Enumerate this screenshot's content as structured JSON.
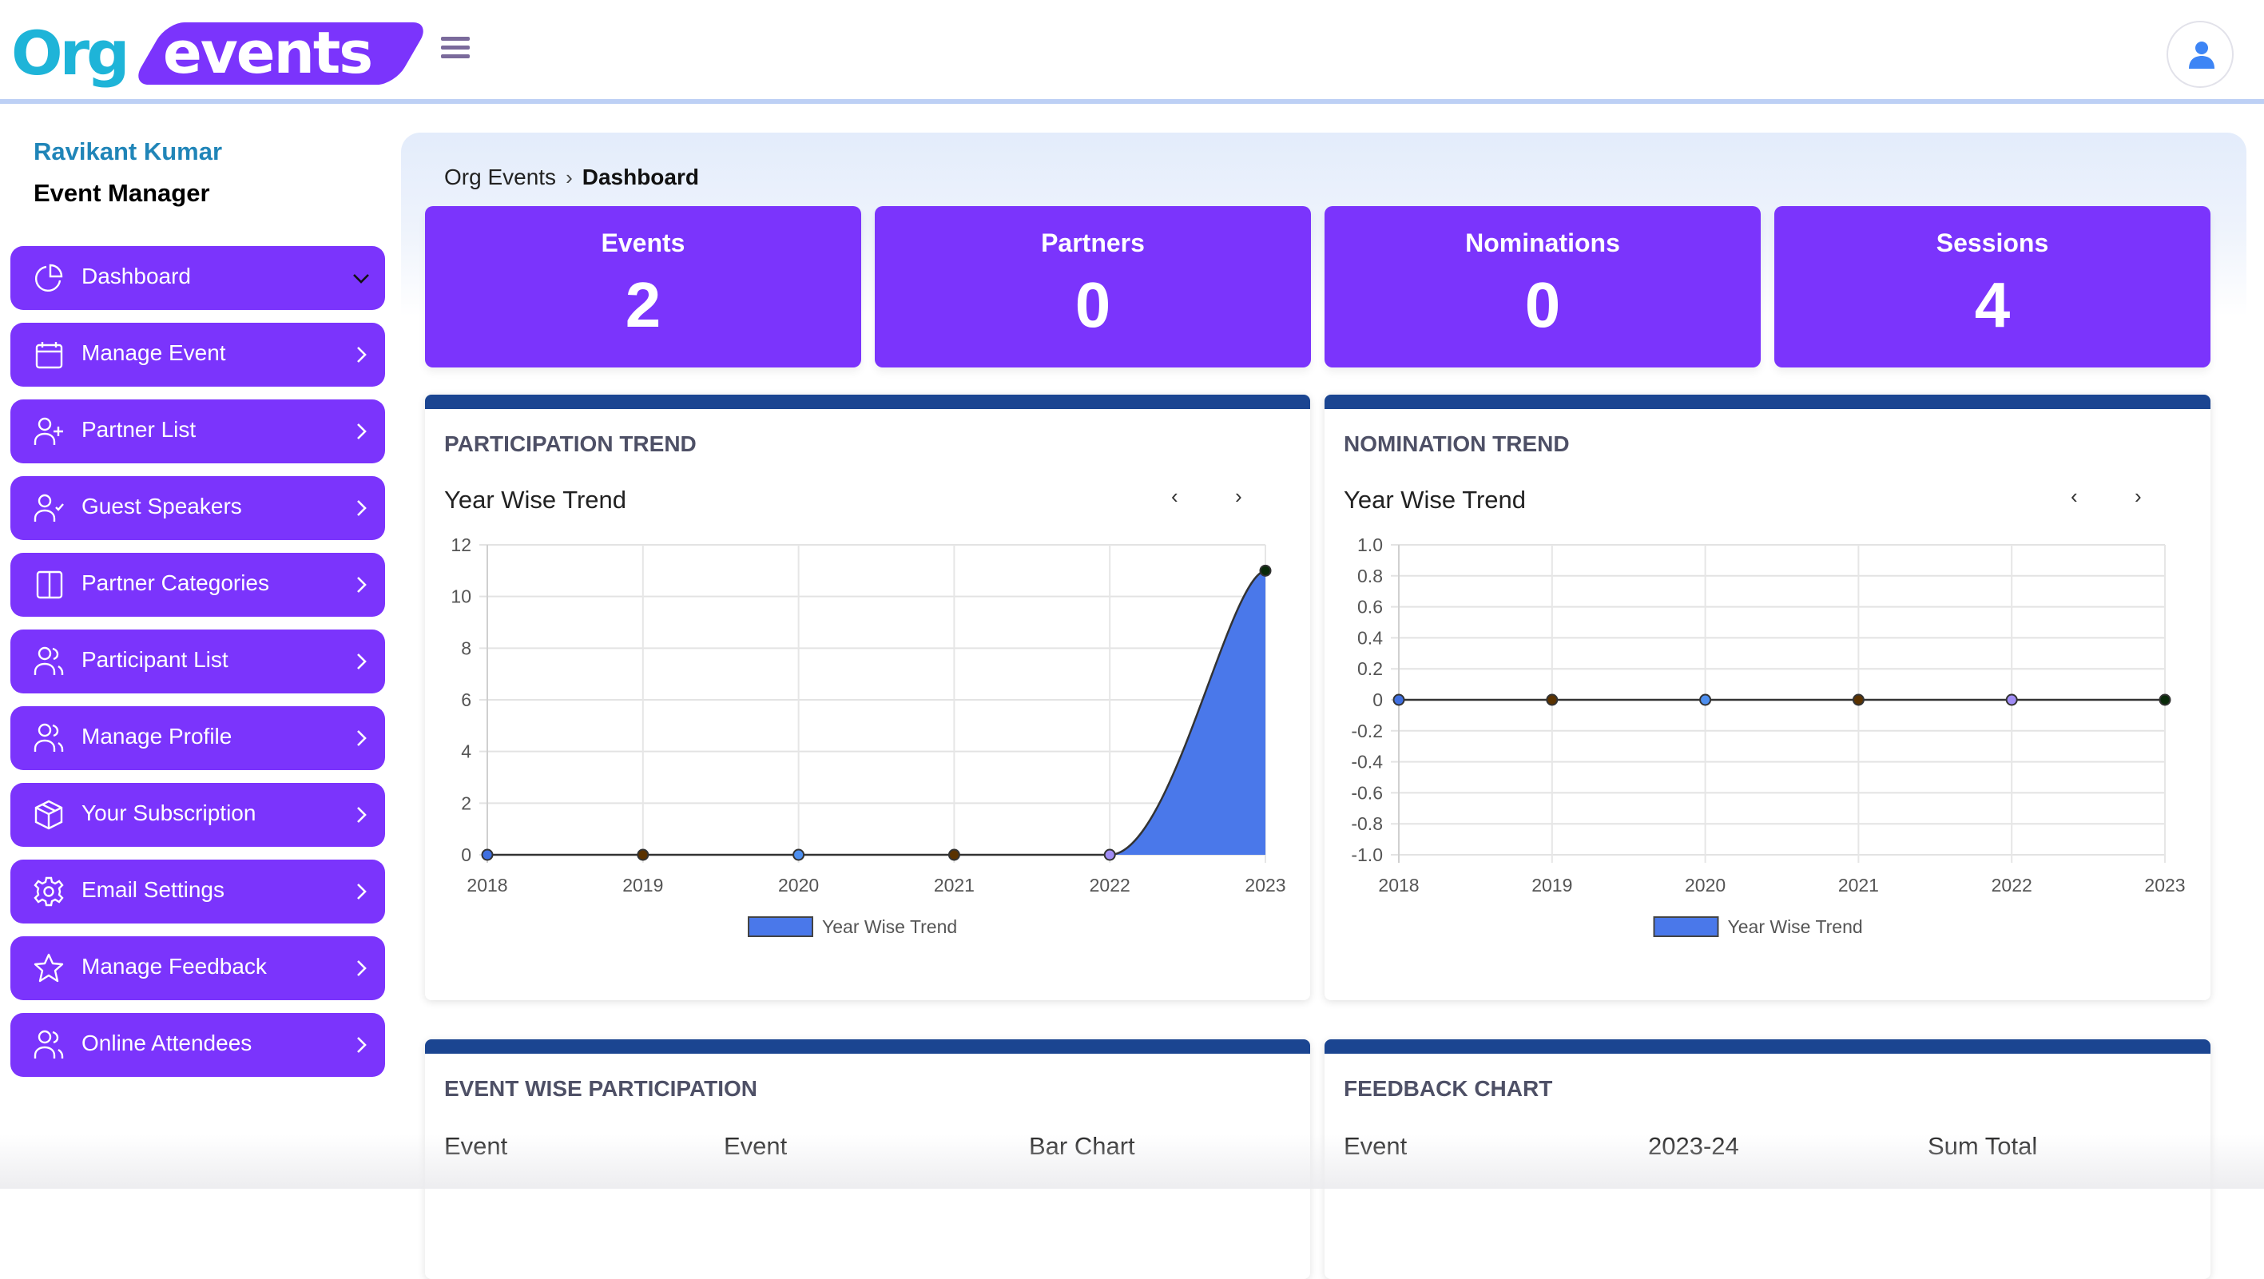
{
  "header": {
    "logo": {
      "part1": "Org",
      "part2": "events"
    },
    "menu_icon": "hamburger-icon",
    "avatar_icon": "user-icon"
  },
  "user": {
    "name": "Ravikant Kumar",
    "role": "Event Manager"
  },
  "sidebar": {
    "items": [
      {
        "label": "Dashboard",
        "icon": "pie-chart-icon",
        "chevron": "chevron-down",
        "active": true
      },
      {
        "label": "Manage Event",
        "icon": "calendar-icon",
        "chevron": "chevron-right"
      },
      {
        "label": "Partner List",
        "icon": "user-plus-icon",
        "chevron": "chevron-right"
      },
      {
        "label": "Guest Speakers",
        "icon": "user-check-icon",
        "chevron": "chevron-right"
      },
      {
        "label": "Partner Categories",
        "icon": "columns-icon",
        "chevron": "chevron-right"
      },
      {
        "label": "Participant List",
        "icon": "users-icon",
        "chevron": "chevron-right"
      },
      {
        "label": "Manage Profile",
        "icon": "users-icon",
        "chevron": "chevron-right"
      },
      {
        "label": "Your Subscription",
        "icon": "package-icon",
        "chevron": "chevron-right"
      },
      {
        "label": "Email Settings",
        "icon": "gear-icon",
        "chevron": "chevron-right"
      },
      {
        "label": "Manage Feedback",
        "icon": "star-icon",
        "chevron": "chevron-right"
      },
      {
        "label": "Online Attendees",
        "icon": "users-icon",
        "chevron": "chevron-right"
      }
    ]
  },
  "breadcrumb": {
    "root": "Org Events",
    "separator": ">",
    "current": "Dashboard"
  },
  "stats": [
    {
      "label": "Events",
      "value": "2"
    },
    {
      "label": "Partners",
      "value": "0"
    },
    {
      "label": "Nominations",
      "value": "0"
    },
    {
      "label": "Sessions",
      "value": "4"
    }
  ],
  "cards": {
    "participation": {
      "title": "PARTICIPATION TREND",
      "subtitle": "Year Wise Trend",
      "prev": "‹",
      "next": "›"
    },
    "nomination": {
      "title": "NOMINATION TREND",
      "subtitle": "Year Wise Trend",
      "prev": "‹",
      "next": "›"
    },
    "event_wise": {
      "title": "EVENT WISE PARTICIPATION",
      "columns": [
        "Event",
        "Event",
        "Bar Chart"
      ]
    },
    "feedback": {
      "title": "FEEDBACK CHART",
      "columns": [
        "Event",
        "2023-24",
        "Sum Total"
      ]
    }
  },
  "colors": {
    "brand_purple": "#7b34fc",
    "brand_cyan": "#1eb4d8",
    "card_topbar": "#1b4591",
    "area_fill": "#4a78ea",
    "point_colors": [
      "#3f6fe0",
      "#5a3200",
      "#4d8ff0",
      "#5a3200",
      "#a08cf5",
      "#0a2a0a"
    ]
  },
  "chart_data": [
    {
      "type": "area",
      "title": "Year Wise Trend",
      "xlabel": "",
      "ylabel": "",
      "categories": [
        "2018",
        "2019",
        "2020",
        "2021",
        "2022",
        "2023"
      ],
      "series": [
        {
          "name": "Year Wise Trend",
          "values": [
            0,
            0,
            0,
            0,
            0,
            11
          ]
        }
      ],
      "ylim": [
        0,
        12
      ],
      "yticks": [
        0,
        2,
        4,
        6,
        8,
        10,
        12
      ],
      "ytick_labels": [
        "0",
        "2",
        "4",
        "6",
        "8",
        "10",
        "12"
      ],
      "grid": true,
      "legend": "bottom"
    },
    {
      "type": "line",
      "title": "Year Wise Trend",
      "xlabel": "",
      "ylabel": "",
      "categories": [
        "2018",
        "2019",
        "2020",
        "2021",
        "2022",
        "2023"
      ],
      "series": [
        {
          "name": "Year Wise Trend",
          "values": [
            0,
            0,
            0,
            0,
            0,
            0
          ]
        }
      ],
      "ylim": [
        -1.0,
        1.0
      ],
      "yticks": [
        -1.0,
        -0.8,
        -0.6,
        -0.4,
        -0.2,
        0,
        0.2,
        0.4,
        0.6,
        0.8,
        1.0
      ],
      "ytick_labels": [
        "-1.0",
        "-0.8",
        "-0.6",
        "-0.4",
        "-0.2",
        "0",
        "0.2",
        "0.4",
        "0.6",
        "0.8",
        "1.0"
      ],
      "grid": true,
      "legend": "bottom"
    }
  ]
}
